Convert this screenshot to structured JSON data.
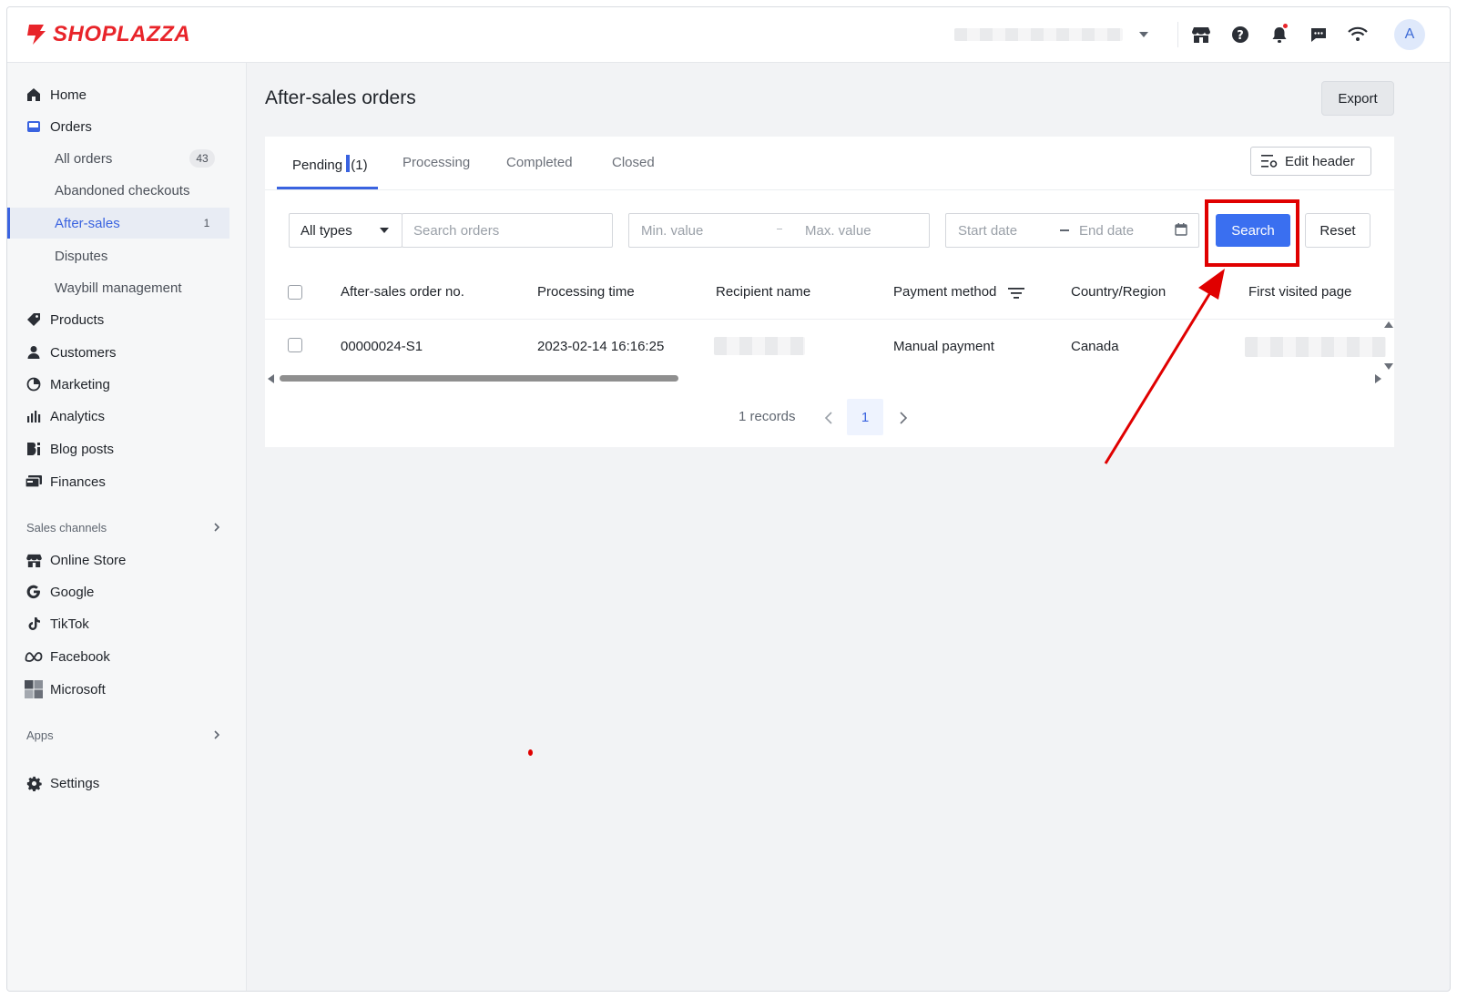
{
  "brand": {
    "name": "SHOPLAZZA",
    "color": "#e8242a"
  },
  "topbar": {
    "icons": [
      "store-icon",
      "help-icon",
      "bell-icon",
      "chat-icon",
      "wifi-icon"
    ],
    "avatar_initial": "A"
  },
  "sidebar": {
    "items": [
      {
        "label": "Home",
        "icon": "home-icon"
      },
      {
        "label": "Orders",
        "icon": "orders-icon"
      },
      {
        "label": "Products",
        "icon": "tag-icon"
      },
      {
        "label": "Customers",
        "icon": "person-icon"
      },
      {
        "label": "Marketing",
        "icon": "marketing-icon"
      },
      {
        "label": "Analytics",
        "icon": "analytics-icon"
      },
      {
        "label": "Blog posts",
        "icon": "blog-icon"
      },
      {
        "label": "Finances",
        "icon": "finances-icon"
      }
    ],
    "orders_sub": [
      {
        "label": "All orders",
        "count": "43"
      },
      {
        "label": "Abandoned checkouts"
      },
      {
        "label": "After-sales",
        "count": "1"
      },
      {
        "label": "Disputes"
      },
      {
        "label": "Waybill management"
      }
    ],
    "sales_channels_label": "Sales channels",
    "channels": [
      {
        "label": "Online Store",
        "icon": "store-icon"
      },
      {
        "label": "Google",
        "icon": "google-icon"
      },
      {
        "label": "TikTok",
        "icon": "tiktok-icon"
      },
      {
        "label": "Facebook",
        "icon": "meta-icon"
      },
      {
        "label": "Microsoft",
        "icon": "microsoft-icon"
      }
    ],
    "apps_label": "Apps",
    "settings_label": "Settings"
  },
  "page": {
    "title": "After-sales orders",
    "export_label": "Export",
    "tabs": [
      {
        "label": "Pending",
        "count": "(1)",
        "active": true
      },
      {
        "label": "Processing"
      },
      {
        "label": "Completed"
      },
      {
        "label": "Closed"
      }
    ],
    "edit_header_label": "Edit header",
    "filters": {
      "type_value": "All types",
      "search_placeholder": "Search orders",
      "min_placeholder": "Min. value",
      "max_placeholder": "Max. value",
      "start_placeholder": "Start date",
      "end_placeholder": "End date",
      "search_button": "Search",
      "reset_button": "Reset"
    },
    "table": {
      "columns": [
        "After-sales order no.",
        "Processing time",
        "Recipient name",
        "Payment method",
        "Country/Region",
        "First visited page"
      ],
      "rows": [
        {
          "order_no": "00000024-S1",
          "processing_time": "2023-02-14 16:16:25",
          "recipient_name": "",
          "payment_method": "Manual payment",
          "country": "Canada",
          "first_visited_page": ""
        }
      ]
    },
    "pagination": {
      "records": "1 records",
      "current_page": "1"
    }
  },
  "annotation_color": "#e00000"
}
